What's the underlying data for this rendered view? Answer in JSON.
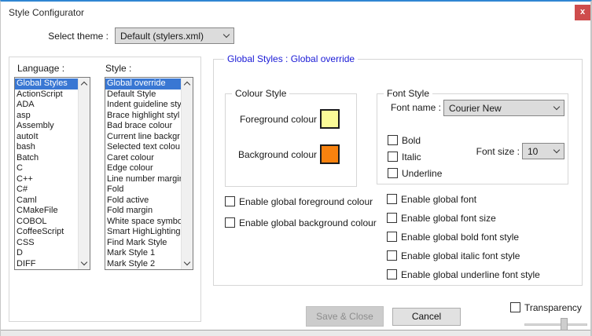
{
  "window": {
    "title": "Style Configurator",
    "close_glyph": "x"
  },
  "theme": {
    "label": "Select theme :",
    "value": "Default (stylers.xml)"
  },
  "language": {
    "label": "Language :",
    "selected_index": 0,
    "items": [
      "Global Styles",
      "ActionScript",
      "ADA",
      "asp",
      "Assembly",
      "autoIt",
      "bash",
      "Batch",
      "C",
      "C++",
      "C#",
      "Caml",
      "CMakeFile",
      "COBOL",
      "CoffeeScript",
      "CSS",
      "D",
      "DIFF"
    ]
  },
  "style": {
    "label": "Style :",
    "selected_index": 0,
    "items": [
      "Global override",
      "Default Style",
      "Indent guideline sty",
      "Brace highlight styl",
      "Bad brace colour",
      "Current line backgr",
      "Selected text colou",
      "Caret colour",
      "Edge colour",
      "Line number margin",
      "Fold",
      "Fold active",
      "Fold margin",
      "White space symbo",
      "Smart HighLighting",
      "Find Mark Style",
      "Mark Style 1",
      "Mark Style 2"
    ]
  },
  "panel": {
    "title": "Global Styles : Global override"
  },
  "colour_style": {
    "title": "Colour Style",
    "foreground_label": "Foreground colour",
    "foreground_color": "#fbfb98",
    "background_label": "Background colour",
    "background_color": "#f8820f"
  },
  "font_style": {
    "title": "Font Style",
    "font_name_label": "Font name :",
    "font_name_value": "Courier New",
    "font_size_label": "Font size :",
    "font_size_value": "10",
    "options": [
      {
        "label": "Bold",
        "checked": false
      },
      {
        "label": "Italic",
        "checked": false
      },
      {
        "label": "Underline",
        "checked": false
      }
    ]
  },
  "overrides": {
    "left": [
      {
        "label": "Enable global foreground colour",
        "checked": false
      },
      {
        "label": "Enable global background colour",
        "checked": false
      }
    ],
    "right": [
      {
        "label": "Enable global font",
        "checked": false
      },
      {
        "label": "Enable global font size",
        "checked": false
      },
      {
        "label": "Enable global bold font style",
        "checked": false
      },
      {
        "label": "Enable global italic font style",
        "checked": false
      },
      {
        "label": "Enable global underline font style",
        "checked": false
      }
    ]
  },
  "footer": {
    "save_label": "Save & Close",
    "save_enabled": false,
    "cancel_label": "Cancel",
    "transparency_label": "Transparency",
    "transparency_checked": false
  },
  "colors": {
    "accent_top": "#2f86d2",
    "selection_blue": "#3977d3",
    "panel_title_blue": "#1a1ad6",
    "close_button_red": "#ce4c4c",
    "foreground_swatch": "#fbfb98",
    "background_swatch": "#f8820f"
  }
}
